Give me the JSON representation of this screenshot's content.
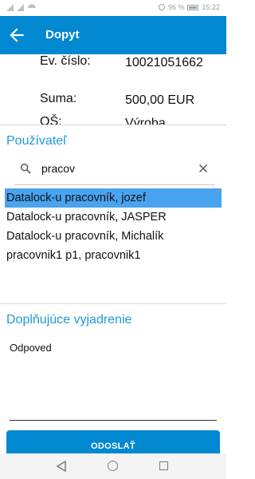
{
  "status_bar": {
    "battery": "96 %",
    "time": "15:22"
  },
  "app_bar": {
    "title": "Dopyt"
  },
  "details": {
    "ev_label": "Ev. číslo:",
    "ev_value": "10021051662",
    "suma_label": "Suma:",
    "suma_value": "500,00 EUR",
    "os_label": "OŠ:",
    "os_value": "Výroba"
  },
  "user_section": {
    "title": "Používateľ",
    "search_value": "pracov",
    "results": [
      {
        "label": "Datalock-u pracovník, jozef",
        "selected": true
      },
      {
        "label": "Datalock-u pracovník, JASPER",
        "selected": false
      },
      {
        "label": "Datalock-u pracovník, Michalík",
        "selected": false
      },
      {
        "label": "pracovnik1 p1, pracovnik1",
        "selected": false
      }
    ]
  },
  "comment_section": {
    "title": "Doplňujúce vyjadrenie",
    "answer": "Odpoved"
  },
  "submit_label": "ODOSLAŤ",
  "colors": {
    "primary": "#0288d1",
    "accent_text": "#1e9bd7",
    "selected_row": "#4aa3f0"
  }
}
